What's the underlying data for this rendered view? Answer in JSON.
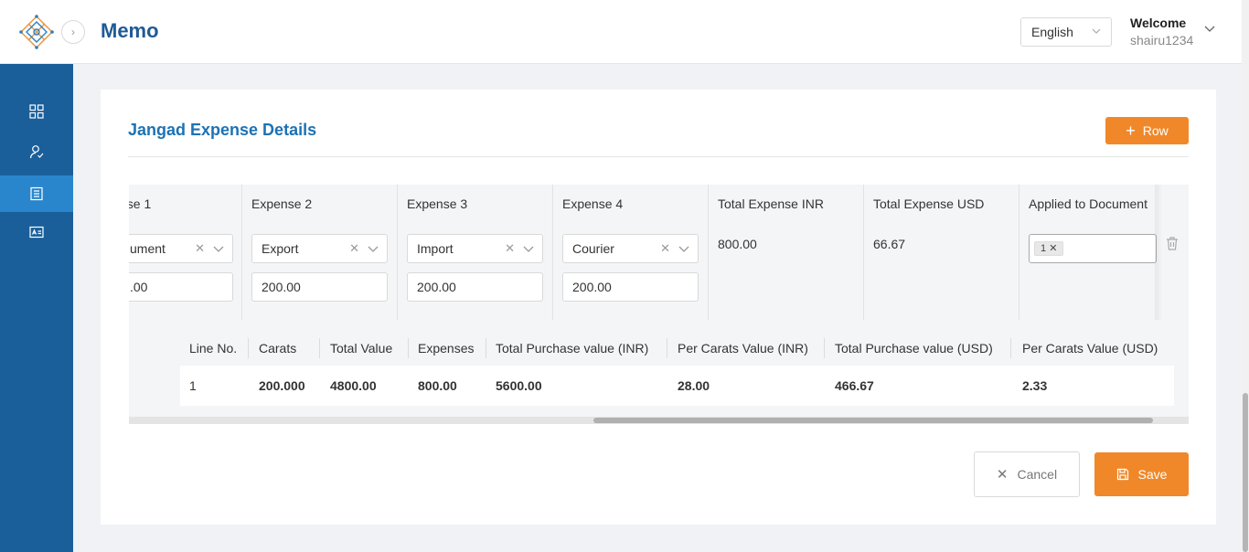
{
  "header": {
    "title": "Memo",
    "language": "English",
    "welcome": "Welcome",
    "username": "shairu1234"
  },
  "sidebar": {
    "items": [
      {
        "icon": "dashboard-grid-icon",
        "active": false
      },
      {
        "icon": "users-icon",
        "active": false
      },
      {
        "icon": "list-document-icon",
        "active": true
      },
      {
        "icon": "id-card-icon",
        "active": false
      }
    ]
  },
  "section": {
    "title": "Jangad Expense Details",
    "add_row_label": "Row"
  },
  "expense_table": {
    "headers": [
      "nse 1",
      "Expense 2",
      "Expense 3",
      "Expense 4",
      "Total Expense INR",
      "Total Expense USD",
      "Applied to Document"
    ],
    "row": {
      "expense1": {
        "type": "ument",
        "amount": ".00"
      },
      "expense2": {
        "type": "Export",
        "amount": "200.00"
      },
      "expense3": {
        "type": "Import",
        "amount": "200.00"
      },
      "expense4": {
        "type": "Courier",
        "amount": "200.00"
      },
      "total_inr": "800.00",
      "total_usd": "66.67",
      "applied_tag": "1"
    }
  },
  "nested_table": {
    "headers": [
      "Line No.",
      "Carats",
      "Total Value",
      "Expenses",
      "Total Purchase value (INR)",
      "Per Carats Value (INR)",
      "Total Purchase value (USD)",
      "Per Carats Value (USD)"
    ],
    "rows": [
      [
        "1",
        "200.000",
        "4800.00",
        "800.00",
        "5600.00",
        "28.00",
        "466.67",
        "2.33"
      ]
    ]
  },
  "actions": {
    "cancel_label": "Cancel",
    "save_label": "Save"
  },
  "colors": {
    "brand_blue": "#1a5f9a",
    "sidebar_active": "#2a86cc",
    "accent_orange": "#f0882a",
    "title_blue": "#1c72b4"
  }
}
